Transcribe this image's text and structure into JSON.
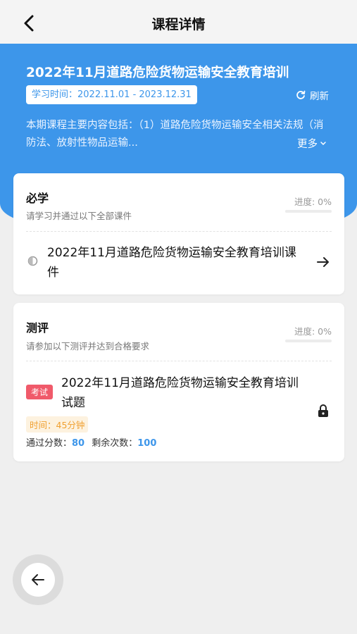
{
  "header": {
    "title": "课程详情",
    "back_icon": "chevron-left-icon"
  },
  "course": {
    "title": "2022年11月道路危险货物运输安全教育培训",
    "study_time": "学习时间：2022.11.01 - 2023.12.31",
    "refresh_label": "刷新",
    "description": "本期课程主要内容包括：（1）道路危险货物运输安全相关法规（消防法、放射性物品运输...",
    "more_label": "更多"
  },
  "required": {
    "title": "必学",
    "subtitle": "请学习并通过以下全部课件",
    "progress_label": "进度: 0%",
    "progress_fraction": 0,
    "item_title": "2022年11月道路危险货物运输安全教育培训课件"
  },
  "assessment": {
    "title": "测评",
    "subtitle": "请参加以下测评并达到合格要求",
    "progress_label": "进度: 0%",
    "progress_fraction": 0,
    "tag": "考试",
    "exam_title": "2022年11月道路危险货物运输安全教育培训试题",
    "time": "时间：45分钟",
    "pass_score_label": "通过分数：",
    "pass_score": "80",
    "remaining_label": "剩余次数：",
    "remaining": "100"
  },
  "colors": {
    "accent": "#3d96ea",
    "tag": "#f05a6a",
    "time_text": "#f0a030"
  }
}
